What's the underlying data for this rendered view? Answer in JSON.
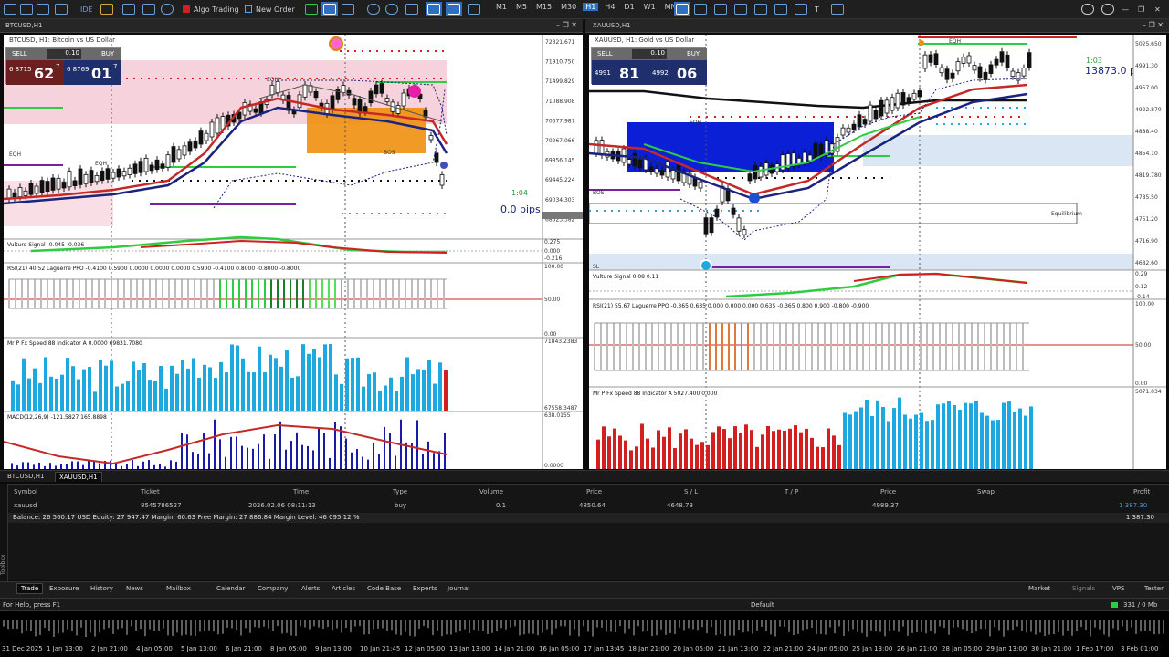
{
  "toolbar": {
    "algo_label": "Algo Trading",
    "new_order_label": "New Order",
    "timeframes": [
      "M1",
      "M5",
      "M15",
      "M30",
      "H1",
      "H4",
      "D1",
      "W1",
      "MN"
    ],
    "active_timeframe": "H1"
  },
  "left_chart": {
    "window_title": "BTCUSD,H1",
    "header": "BTCUSD, H1:  Bitcoin vs US Dollar",
    "trade": {
      "lot": "0.10",
      "sell_label": "SELL",
      "buy_label": "BUY",
      "sell_small": "6 8715",
      "sell_big": "62",
      "sell_sup": "7",
      "buy_small": "6 8769",
      "buy_big": "01",
      "buy_sup": "7"
    },
    "timer": "1:04",
    "pips": "0.0 pips",
    "price_axis": [
      "72321.671",
      "71910.750",
      "71499.829",
      "71088.908",
      "70677.987",
      "70267.066",
      "69856.145",
      "69445.224",
      "69034.303",
      "68623.382"
    ],
    "marker_labels": [
      "EQH",
      "EQH",
      "EQH",
      "BOS",
      "EQH"
    ],
    "indicators": {
      "vulture": "Vulture Signal -0.045 -0.036",
      "vulture_axis": [
        "0.275",
        "0.000",
        "-0.216"
      ],
      "rsi": "RSI(21) 40.52 Laguerre PPO -0.4100 0.5900 0.0000 0.0000 0.0000 0.5900 -0.4100 0.8000 -0.8000 -0.8000",
      "rsi_axis": [
        "100.00",
        "50.00",
        "0.00"
      ],
      "speed": "Mr P Fx Speed 88 Indicator A 0.0000 69831.7080",
      "speed_axis": [
        "71843.2383",
        "67558.3487"
      ],
      "macd": "MACD(12,26,9) -121.5827 165.8898",
      "macd_axis": [
        "638.0155",
        "0.0000"
      ]
    }
  },
  "right_chart": {
    "window_title": "XAUUSD,H1",
    "header": "XAUUSD, H1:  Gold vs US Dollar",
    "trade": {
      "lot": "0.10",
      "sell_label": "SELL",
      "buy_label": "BUY",
      "sell_small": "4991",
      "sell_big": "81",
      "buy_small": "4992",
      "buy_big": "06"
    },
    "timer": "1:03",
    "pips": "13873.0 p",
    "price_axis": [
      "5025.650",
      "4991.30",
      "4957.00",
      "4922.870",
      "4888.40",
      "4854.10",
      "4819.780",
      "4785.50",
      "4751.20",
      "4716.90",
      "4682.60"
    ],
    "marker_labels": [
      "EQH",
      "EQH",
      "BOS",
      "SL",
      "Equilibrium"
    ],
    "indicators": {
      "vulture": "Vulture Signal 0.08 0.11",
      "vulture_axis": [
        "0.29",
        "0.12",
        "-0.14"
      ],
      "rsi": "RSI(21) 55.67 Laguerre PPO -0.365 0.635 0.000 0.000 0.000 0.635 -0.365 0.800 0.900 -0.800 -0.900",
      "rsi_axis": [
        "100.00",
        "50.00",
        "0.00"
      ],
      "speed": "Mr P Fx Speed 88 Indicator A 5027.400 0.000",
      "speed_axis": [
        "5071.034"
      ]
    }
  },
  "chart_tabs": [
    "BTCUSD,H1",
    "XAUUSD,H1"
  ],
  "active_chart_tab": "XAUUSD,H1",
  "trade_table": {
    "headers": [
      "Symbol",
      "Ticket",
      "Time",
      "Type",
      "Volume",
      "Price",
      "S / L",
      "T / P",
      "Price",
      "Swap",
      "Profit"
    ],
    "row": {
      "symbol": "xauusd",
      "ticket": "8545786527",
      "time": "2026.02.06 08:11:13",
      "type": "buy",
      "volume": "0.1",
      "price": "4850.64",
      "sl": "4648.78",
      "tp": "",
      "current_price": "4989.37",
      "swap": "",
      "profit": "1 387.30"
    },
    "balance_text": "Balance: 26 560.17 USD  Equity: 27 947.47  Margin: 60.63  Free Margin: 27 886.84  Margin Level: 46 095.12 %",
    "balance_profit": "1 387.30"
  },
  "toolbox_label": "Toolbox",
  "bottom_tabs": [
    "Trade",
    "Exposure",
    "History",
    "News",
    "Mailbox",
    "Calendar",
    "Company",
    "Alerts",
    "Articles",
    "Code Base",
    "Experts",
    "Journal"
  ],
  "active_bottom_tab": "Trade",
  "bottom_right": [
    "Market",
    "Signals",
    "VPS",
    "Tester"
  ],
  "status": {
    "help": "For Help, press F1",
    "profile": "Default",
    "traffic": "331 / 0 Mb"
  },
  "time_axis": [
    "31 Dec 2025",
    "1 Jan 13:00",
    "2 Jan 21:00",
    "4 Jan 05:00",
    "5 Jan 13:00",
    "6 Jan 21:00",
    "8 Jan 05:00",
    "9 Jan 13:00",
    "10 Jan 21:45",
    "12 Jan 05:00",
    "13 Jan 13:00",
    "14 Jan 21:00",
    "16 Jan 05:00",
    "17 Jan 13:45",
    "18 Jan 21:00",
    "20 Jan 05:00",
    "21 Jan 13:00",
    "22 Jan 21:00",
    "24 Jan 05:00",
    "25 Jan 13:00",
    "26 Jan 21:00",
    "28 Jan 05:00",
    "29 Jan 13:00",
    "30 Jan 21:00",
    "1 Feb 17:00",
    "3 Feb 01:00"
  ],
  "colors": {
    "bull": "#1ea8e0",
    "bear": "#d21f1f",
    "accent": "#2f6fc0",
    "green": "#2ecc40"
  }
}
